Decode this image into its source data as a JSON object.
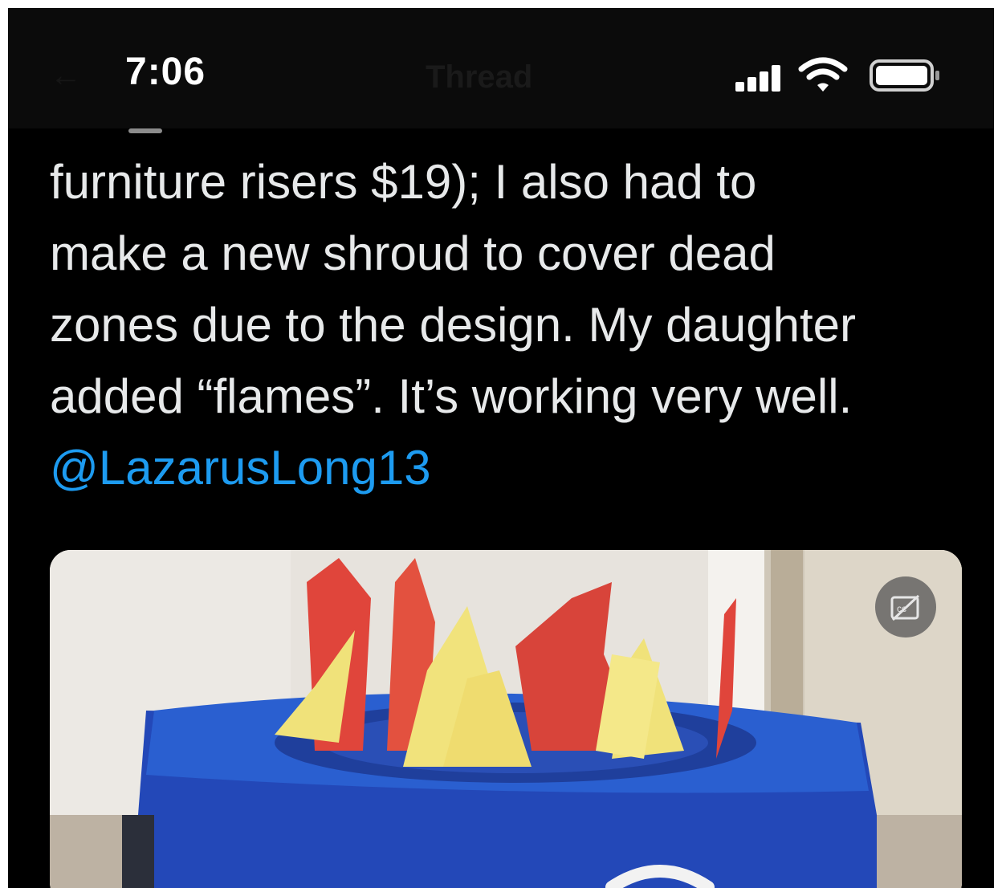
{
  "status_bar": {
    "time": "7:06",
    "signal_icon": "signal-bars-icon",
    "wifi_icon": "wifi-icon",
    "battery_icon": "battery-icon"
  },
  "header": {
    "title": "Thread"
  },
  "tweet": {
    "lines": [
      "furniture risers $19); I also had to",
      "make a new shroud to cover dead",
      "zones due to the design. My daughter",
      "added “flames”. It’s working very well."
    ],
    "mention": "@LazarusLong13"
  },
  "media": {
    "captions_icon": "closed-captions-off-icon",
    "colors": {
      "blue": "#2a5fd0",
      "red": "#e0453b",
      "yellow": "#f0e27a"
    }
  },
  "colors": {
    "background": "#000000",
    "text": "#e7e9ea",
    "link": "#1d9bf0"
  }
}
